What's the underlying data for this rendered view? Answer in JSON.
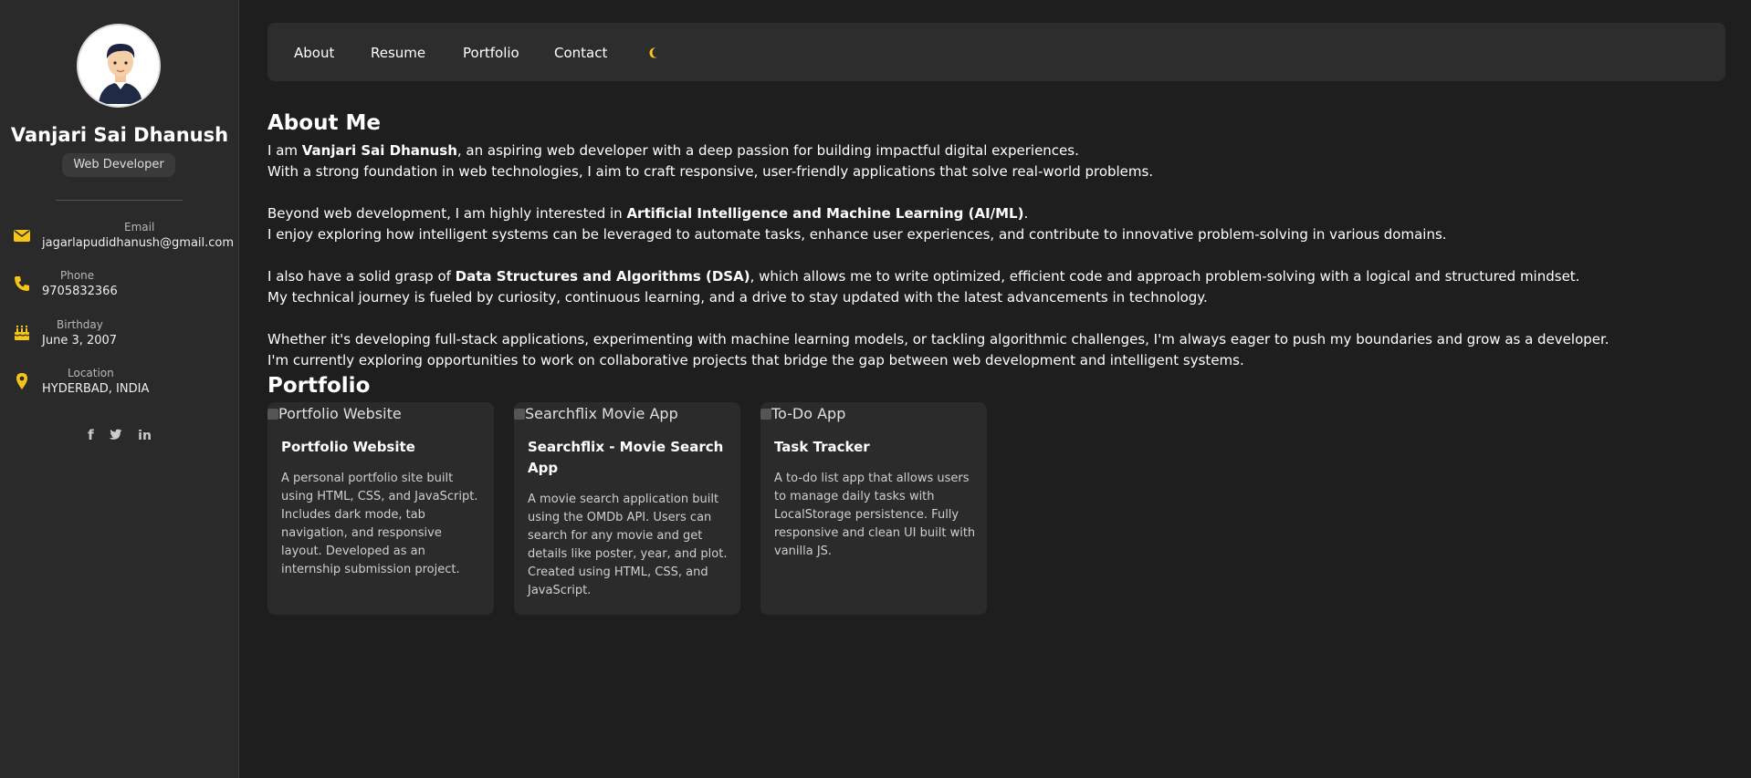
{
  "profile": {
    "name": "Vanjari Sai Dhanush",
    "role": "Web Developer",
    "contacts": [
      {
        "label": "Email",
        "value": "jagarlapudidhanush@gmail.com",
        "icon": "envelope-icon"
      },
      {
        "label": "Phone",
        "value": "9705832366",
        "icon": "phone-icon"
      },
      {
        "label": "Birthday",
        "value": "June 3, 2007",
        "icon": "cake-icon"
      },
      {
        "label": "Location",
        "value": "HYDERBAD, INDIA",
        "icon": "location-pin-icon"
      }
    ],
    "socials": [
      {
        "name": "facebook-icon",
        "glyph": "f"
      },
      {
        "name": "twitter-icon",
        "glyph": "🐦"
      },
      {
        "name": "linkedin-icon",
        "glyph": "in"
      }
    ]
  },
  "nav": {
    "items": [
      "About",
      "Resume",
      "Portfolio",
      "Contact"
    ],
    "theme_toggle_icon": "moon-icon"
  },
  "about": {
    "heading": "About Me",
    "p1_pre": "I am ",
    "p1_bold": "Vanjari Sai Dhanush",
    "p1_post": ", an aspiring web developer with a deep passion for building impactful digital experiences.",
    "p2": "With a strong foundation in web technologies, I aim to craft responsive, user-friendly applications that solve real-world problems.",
    "p3_pre": "Beyond web development, I am highly interested in ",
    "p3_bold": "Artificial Intelligence and Machine Learning (AI/ML)",
    "p3_post": ".",
    "p4": "I enjoy exploring how intelligent systems can be leveraged to automate tasks, enhance user experiences, and contribute to innovative problem-solving in various domains.",
    "p5_pre": "I also have a solid grasp of ",
    "p5_bold": "Data Structures and Algorithms (DSA)",
    "p5_post": ", which allows me to write optimized, efficient code and approach problem-solving with a logical and structured mindset.",
    "p6": "My technical journey is fueled by curiosity, continuous learning, and a drive to stay updated with the latest advancements in technology.",
    "p7": "Whether it's developing full-stack applications, experimenting with machine learning models, or tackling algorithmic challenges, I'm always eager to push my boundaries and grow as a developer.",
    "p8": "I'm currently exploring opportunities to work on collaborative projects that bridge the gap between web development and intelligent systems."
  },
  "portfolio": {
    "heading": "Portfolio",
    "projects": [
      {
        "img_alt": "Portfolio Website",
        "title": "Portfolio Website",
        "description": "A personal portfolio site built using HTML, CSS, and JavaScript. Includes dark mode, tab navigation, and responsive layout. Developed as an internship submission project."
      },
      {
        "img_alt": "Searchflix Movie App",
        "title": "Searchflix - Movie Search App",
        "description": "A movie search application built using the OMDb API. Users can search for any movie and get details like poster, year, and plot. Created using HTML, CSS, and JavaScript."
      },
      {
        "img_alt": "To-Do App",
        "title": "Task Tracker",
        "description": "A to-do list app that allows users to manage daily tasks with LocalStorage persistence. Fully responsive and clean UI built with vanilla JS."
      }
    ]
  },
  "colors": {
    "background": "#1e1e1e",
    "sidebar": "#2a2a2a",
    "accent_icon": "#f5c518",
    "card": "#2b2b2b"
  }
}
